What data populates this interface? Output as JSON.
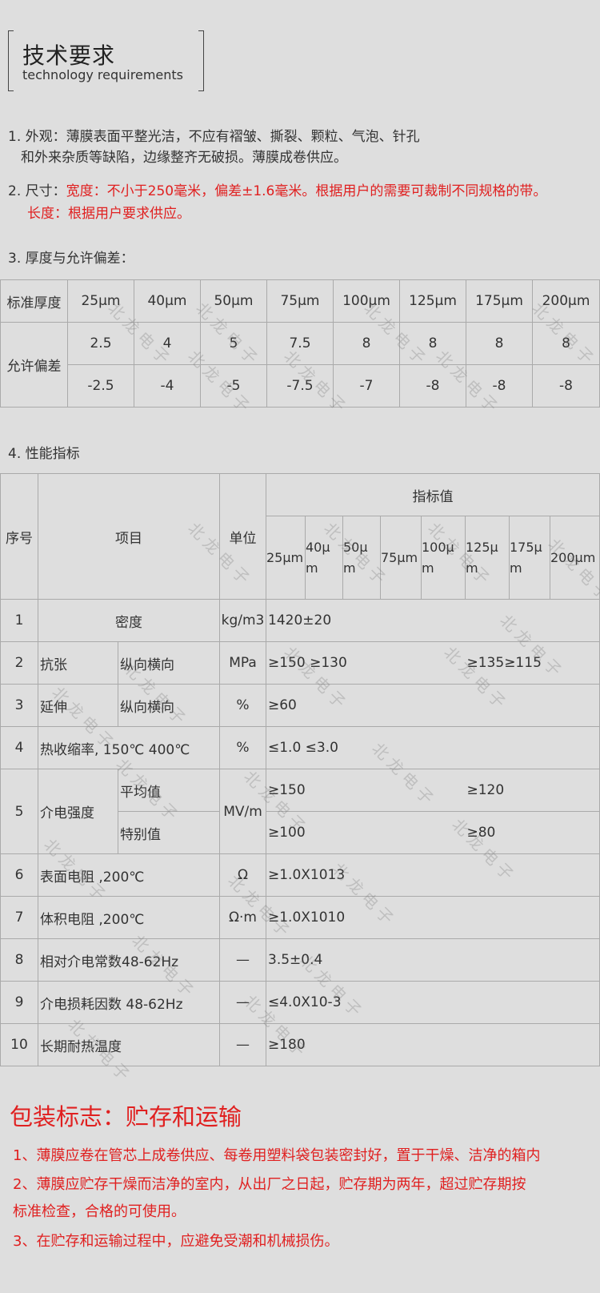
{
  "header": {
    "title": "技术要求",
    "subtitle": "technology requirements"
  },
  "section1": {
    "line1": "1. 外观：薄膜表面平整光洁，不应有褶皱、撕裂、颗粒、气泡、针孔",
    "line2": "和外来杂质等缺陷，边缘整齐无破损。薄膜成卷供应。"
  },
  "section2": {
    "prefix": "2. 尺寸：",
    "width_text": "宽度：不小于250毫米，偏差±1.6毫米。根据用户的需要可裁制不同规格的带。",
    "length_text": "长度：根据用户要求供应。"
  },
  "section3": {
    "heading": "3. 厚度与允许偏差：",
    "row_label_thickness": "标准厚度",
    "row_label_deviation": "允许偏差",
    "thicknesses": [
      "25μm",
      "40μm",
      "50μm",
      "75μm",
      "100μm",
      "125μm",
      "175μm",
      "200μm"
    ],
    "plus": [
      "2.5",
      "4",
      "5",
      "7.5",
      "8",
      "8",
      "8",
      "8"
    ],
    "minus": [
      "-2.5",
      "-4",
      "-5",
      "-7.5",
      "-7",
      "-8",
      "-8",
      "-8"
    ]
  },
  "section4": {
    "heading": "4. 性能指标",
    "col_no": "序号",
    "col_item": "项目",
    "col_unit": "单位",
    "col_value": "指标值",
    "sizes": [
      "25μm",
      "40μm",
      "50μm",
      "75μm",
      "100μm",
      "125μm",
      "175μm",
      "200μm"
    ],
    "rows": [
      {
        "no": "1",
        "item": "密度",
        "unit": "kg/m3",
        "value": "1420±20"
      },
      {
        "no": "2",
        "item": "抗张",
        "sub": "纵向横向",
        "unit": "MPa",
        "value": "≥150  ≥130",
        "value2": "≥135≥115"
      },
      {
        "no": "3",
        "item": "延伸",
        "sub": "纵向横向",
        "unit": "%",
        "value": "≥60"
      },
      {
        "no": "4",
        "item": "热收缩率, 150℃  400℃",
        "unit": "%",
        "value": "≤1.0  ≤3.0"
      },
      {
        "no": "5",
        "item": "介电强度",
        "sub": "平均值",
        "sub2": "特别值",
        "unit": "MV/m",
        "value": "≥150",
        "value2": "≥120",
        "value3": "≥100",
        "value4": "≥80"
      },
      {
        "no": "6",
        "item": "表面电阻 ,200℃",
        "unit": "Ω",
        "value": "≥1.0X1013"
      },
      {
        "no": "7",
        "item": "体积电阻 ,200℃",
        "unit": "Ω·m",
        "value": "≥1.0X1010"
      },
      {
        "no": "8",
        "item": "相对介电常数48-62Hz",
        "unit": "—",
        "value": "3.5±0.4"
      },
      {
        "no": "9",
        "item": "介电损耗因数 48-62Hz",
        "unit": "—",
        "value": "≤4.0X10-3"
      },
      {
        "no": "10",
        "item": "长期耐热温度",
        "unit": "—",
        "value": "≥180"
      }
    ]
  },
  "packaging": {
    "title": "包装标志：贮存和运输",
    "line1": "1、薄膜应卷在管芯上成卷供应、每卷用塑料袋包装密封好，置于干燥、洁净的箱内",
    "line2a": "2、薄膜应贮存干燥而洁净的室内，从出厂之日起，贮存期为两年，超过贮存期按",
    "line2b": "标准检查，合格的可使用。",
    "line3": "3、在贮存和运输过程中，应避免受潮和机械损伤。"
  },
  "watermark": "北龙电子"
}
